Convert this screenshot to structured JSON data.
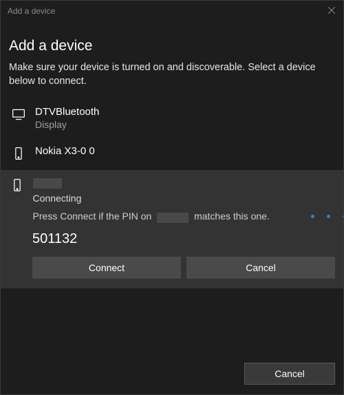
{
  "titlebar": {
    "title": "Add a device"
  },
  "header": {
    "title": "Add a device",
    "subtitle": "Make sure your device is turned on and discoverable. Select a device below to connect."
  },
  "devices": [
    {
      "icon": "monitor",
      "name": "DTVBluetooth",
      "sub": "Display"
    },
    {
      "icon": "phone",
      "name": "Nokia X3-0 0",
      "sub": ""
    }
  ],
  "selected": {
    "icon": "phone",
    "status": "Connecting",
    "instruction_prefix": "Press Connect if the PIN on",
    "instruction_suffix": "matches this one.",
    "pin": "501132",
    "connect_label": "Connect",
    "cancel_label": "Cancel"
  },
  "footer": {
    "cancel_label": "Cancel"
  }
}
